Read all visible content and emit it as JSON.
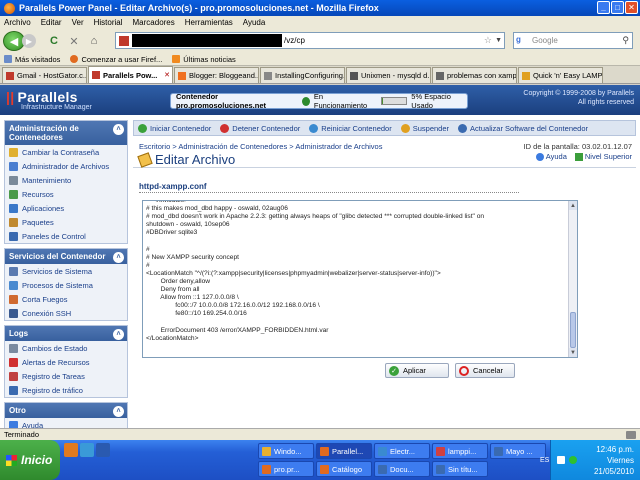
{
  "window": {
    "title": "Parallels Power Panel - Editar Archivo(s) - pro.promosoluciones.net - Mozilla Firefox",
    "min_label": "_",
    "max_label": "□",
    "close_label": "✕"
  },
  "menu": [
    "Archivo",
    "Editar",
    "Ver",
    "Historial",
    "Marcadores",
    "Herramientas",
    "Ayuda"
  ],
  "nav": {
    "back_glyph": "◀",
    "forward_glyph": "▶",
    "reload_glyph": "C",
    "stop_glyph": "✕",
    "home_glyph": "⌂",
    "url_suffix": "/vz/cp",
    "star_glyph": "☆",
    "dropdown_glyph": "▼",
    "search_engine_label": "g",
    "search_placeholder": "Google",
    "search_glyph": "⚲"
  },
  "bookmarks": [
    "Más visitados",
    "Comenzar a usar Firef...",
    "Últimas noticias"
  ],
  "tabs": [
    {
      "label": "Gmail - HostGator.c...",
      "active": false,
      "color": "#c0392b"
    },
    {
      "label": "Parallels Pow...",
      "active": true,
      "color": "#c0392b"
    },
    {
      "label": "Blogger: Bloggeand...",
      "active": false,
      "color": "#f07020"
    },
    {
      "label": "InstallingConfiguring...",
      "active": false,
      "color": "#888888"
    },
    {
      "label": "Unixmen - mysqld d...",
      "active": false,
      "color": "#555555"
    },
    {
      "label": "problemas con xamp...",
      "active": false,
      "color": "#666666"
    },
    {
      "label": "Quick 'n' Easy LAMP ...",
      "active": false,
      "color": "#e0a020"
    }
  ],
  "tab_close_glyph": "✕",
  "banner": {
    "logo_bars": "||",
    "logo": "Parallels",
    "logo_sub": "Infrastructure Manager",
    "container_label": "Contenedor pro.promosoluciones.net",
    "container_status": "En Funcionamiento",
    "disk_usage_percent": 5,
    "disk_text": "5% Espacio Usado",
    "copyright_1": "Copyright © 1999-2008 by Parallels",
    "copyright_2": "All rights reserved"
  },
  "sidebar": {
    "collapse_glyph": "˄",
    "sections": [
      {
        "title": "Administración de Contenedores",
        "items": [
          {
            "label": "Cambiar la Contraseña",
            "color": "#e0b030"
          },
          {
            "label": "Administrador de Archivos",
            "color": "#4a7ed0"
          },
          {
            "label": "Mantenimiento",
            "color": "#7a8a9a"
          },
          {
            "label": "Recursos",
            "color": "#4a9a4a"
          },
          {
            "label": "Aplicaciones",
            "color": "#3a78c8"
          },
          {
            "label": "Paquetes",
            "color": "#c08a30"
          },
          {
            "label": "Paneles de Control",
            "color": "#3a6ab0"
          }
        ]
      },
      {
        "title": "Servicios del Contenedor",
        "items": [
          {
            "label": "Servicios de Sistema",
            "color": "#5a7ab0"
          },
          {
            "label": "Procesos de Sistema",
            "color": "#4a8ad0"
          },
          {
            "label": "Corta Fuegos",
            "color": "#d06a30"
          },
          {
            "label": "Conexión SSH",
            "color": "#3a5a90"
          }
        ]
      },
      {
        "title": "Logs",
        "items": [
          {
            "label": "Cambios de Estado",
            "color": "#7a8aa0"
          },
          {
            "label": "Alertas de Recursos",
            "color": "#d03030"
          },
          {
            "label": "Registro de Tareas",
            "color": "#c04040"
          },
          {
            "label": "Registro de tráfico",
            "color": "#3a6ab0"
          }
        ]
      },
      {
        "title": "Otro",
        "items": [
          {
            "label": "Ayuda",
            "color": "#3b7be0"
          }
        ]
      }
    ]
  },
  "actions": [
    {
      "label": "Iniciar Contenedor",
      "color": "#3aa13a"
    },
    {
      "label": "Detener Contenedor",
      "color": "#d03030"
    },
    {
      "label": "Reiniciar Contenedor",
      "color": "#3a8ad0"
    },
    {
      "label": "Suspender",
      "color": "#e0a020"
    },
    {
      "label": "Actualizar Software del Contenedor",
      "color": "#3a6ab0"
    }
  ],
  "breadcrumb": "Escritorio > Administración de Contenedores > Administrador de Archivos",
  "page_title": "Editar Archivo",
  "screen_id": "ID de la pantalla: 03.02.01.12.07",
  "help_label": "Ayuda",
  "up_label": "Nivel Superior",
  "file_name": "httpd-xampp.conf",
  "editor_text": "    </IfModule>\n# this makes mod_dbd happy - oswald, 02aug06\n# mod_dbd doesn't work in Apache 2.2.3: getting always heaps of \"glibc detected *** corrupted double-linked list\" on\nshutdown - oswald, 10sep06\n#DBDriver sqlite3\n\n#\n# New XAMPP security concept\n#\n<LocationMatch \"^/(?i:(?:xampp|security|licenses|phpmyadmin|webalizer|server-status|server-info))\">\n        Order deny,allow\n        Deny from all\n        Allow from ::1 127.0.0.0/8 \\\n                fc00::/7 10.0.0.0/8 172.16.0.0/12 192.168.0.0/16 \\\n                fe80::/10 169.254.0.0/16\n\n        ErrorDocument 403 /error/XAMPP_FORBIDDEN.html.var\n</LocationMatch>",
  "scroll_up_glyph": "▲",
  "scroll_down_glyph": "▼",
  "buttons": {
    "apply": "Aplicar",
    "apply_glyph": "✓",
    "cancel": "Cancelar"
  },
  "status_text": "Terminado",
  "taskbar": {
    "start": "Inicio",
    "row1": [
      {
        "label": "Windo...",
        "color": "#e8b030",
        "active": false
      },
      {
        "label": "Parallel...",
        "color": "#e06a20",
        "active": true
      },
      {
        "label": "Electr...",
        "color": "#3a8ad0",
        "active": false
      },
      {
        "label": "lamppi...",
        "color": "#d04040",
        "active": false
      },
      {
        "label": "Mayo ...",
        "color": "#3a6ab0",
        "active": false
      }
    ],
    "row2": [
      {
        "label": "pro.pr...",
        "color": "#e06a20",
        "active": false
      },
      {
        "label": "Catálogo",
        "color": "#e06a20",
        "active": false
      },
      {
        "label": "Docu...",
        "color": "#3a6ab0",
        "active": false
      },
      {
        "label": "Sin títu...",
        "color": "#3a6ab0",
        "active": false
      }
    ],
    "lang": "ES",
    "time": "12:46 p.m.",
    "day": "Viernes",
    "date": "21/05/2010"
  }
}
